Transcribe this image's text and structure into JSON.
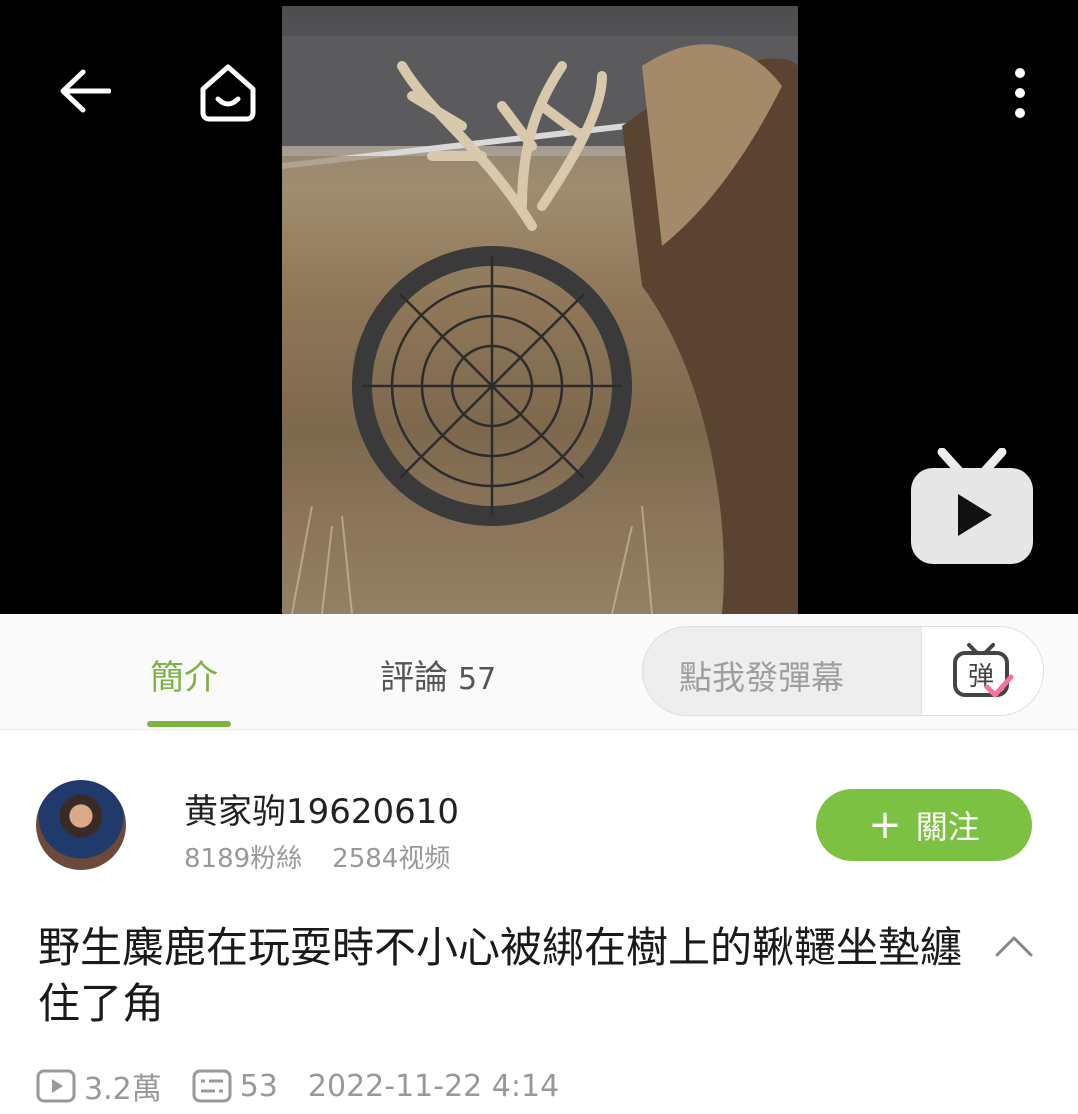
{
  "video": {
    "title": "野生麋鹿在玩耍時不小心被綁在樹上的鞦韆坐墊纏住了角"
  },
  "tabs": {
    "intro": "簡介",
    "comments_label": "評論",
    "comments_count": "57"
  },
  "danmaku": {
    "placeholder": "點我發彈幕",
    "button_glyph": "弹"
  },
  "uploader": {
    "name": "黄家驹19620610",
    "fans": "8189粉絲",
    "videos": "2584视频"
  },
  "follow": {
    "label": "關注",
    "color": "#7cc142"
  },
  "meta": {
    "views": "3.2萬",
    "danmaku_count": "53",
    "datetime": "2022-11-22 4:14"
  },
  "colors": {
    "accent": "#7cb342",
    "pink": "#fb7299"
  }
}
